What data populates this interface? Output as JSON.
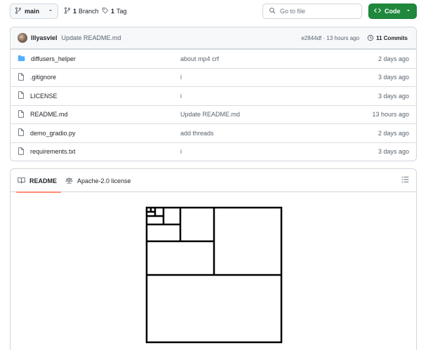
{
  "topbar": {
    "branch_label": "main",
    "branches_count": "1",
    "branches_label": "Branch",
    "tags_count": "1",
    "tags_label": "Tag",
    "search_placeholder": "Go to file",
    "code_label": "Code"
  },
  "commit": {
    "author": "lllyasviel",
    "message": "Update README.md",
    "hash_time": "e2844df · 13 hours ago",
    "commits_label": "11 Commits"
  },
  "files": [
    {
      "name": "diffusers_helper",
      "type": "folder",
      "message": "about mp4 crf",
      "date": "2 days ago"
    },
    {
      "name": ".gitignore",
      "type": "file",
      "message": "i",
      "date": "3 days ago"
    },
    {
      "name": "LICENSE",
      "type": "file",
      "message": "i",
      "date": "3 days ago"
    },
    {
      "name": "README.md",
      "type": "file",
      "message": "Update README.md",
      "date": "13 hours ago"
    },
    {
      "name": "demo_gradio.py",
      "type": "file",
      "message": "add threads",
      "date": "2 days ago"
    },
    {
      "name": "requirements.txt",
      "type": "file",
      "message": "i",
      "date": "3 days ago"
    }
  ],
  "readme": {
    "tab_readme": "README",
    "tab_license": "Apache-2.0 license"
  },
  "colors": {
    "accent_green": "#1f883d",
    "folder_blue": "#54aeff",
    "tab_underline": "#fd8c73"
  }
}
